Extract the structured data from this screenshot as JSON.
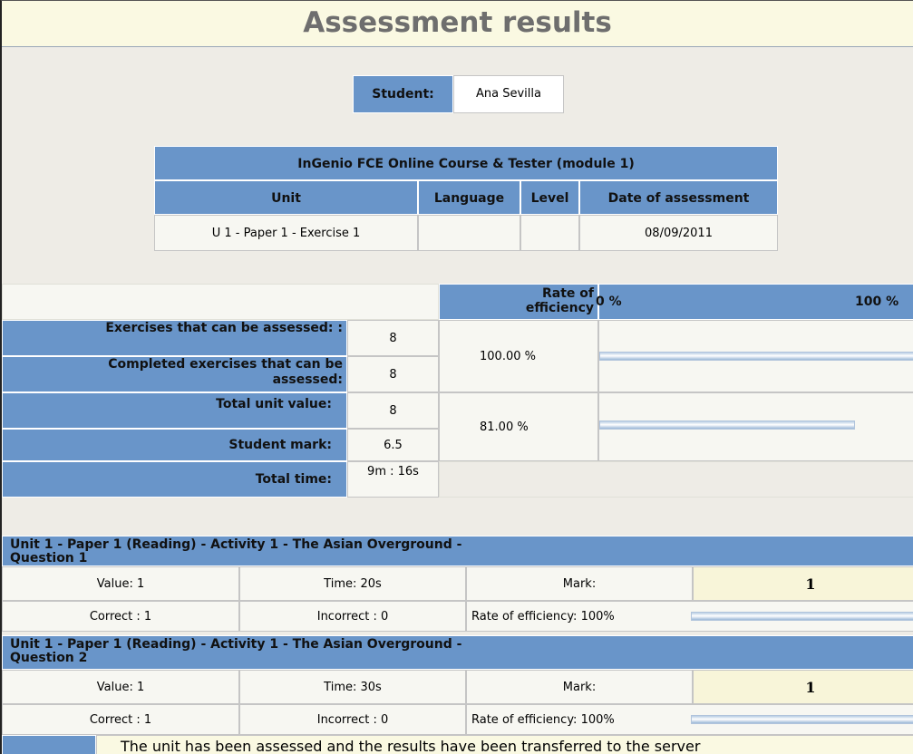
{
  "header": {
    "title": "Assessment results"
  },
  "student": {
    "label": "Student:",
    "name": "Ana Sevilla"
  },
  "course": {
    "title": "InGenio FCE Online Course & Tester (module 1)",
    "columns": [
      "Unit",
      "Language",
      "Level",
      "Date of assessment"
    ],
    "row": {
      "unit": "U 1 - Paper 1 - Exercise 1",
      "language": "",
      "level": "",
      "date": "08/09/2011"
    }
  },
  "summary": {
    "rate_label": "Rate of efficiency",
    "scale_min": "0 %",
    "scale_max": "100 %",
    "rows": [
      {
        "label": "Exercises that can be assessed: :",
        "value": "8"
      },
      {
        "label": "Completed exercises that can be assessed:",
        "value": "8"
      },
      {
        "label": "Total unit value:",
        "value": "8"
      },
      {
        "label": "Student mark:",
        "value": "6.5"
      },
      {
        "label": "Total time:",
        "value": "9m : 16s"
      }
    ],
    "rates": [
      {
        "text": "100.00 %",
        "fraction": 1.0
      },
      {
        "text": "81.00 %",
        "fraction": 0.81
      }
    ]
  },
  "questions": [
    {
      "title": "Unit 1 - Paper 1 (Reading) - Activity 1 - The Asian Overground - Question 1",
      "value": "Value: 1",
      "time": "Time: 20s",
      "mark_label": "Mark:",
      "mark": "1",
      "correct": "Correct : 1",
      "incorrect": "Incorrect : 0",
      "rate": "Rate of efficiency: 100%",
      "rate_fraction": 1.0
    },
    {
      "title": "Unit 1 - Paper 1 (Reading) - Activity 1 - The Asian Overground - Question 2",
      "value": "Value: 1",
      "time": "Time: 30s",
      "mark_label": "Mark:",
      "mark": "1",
      "correct": "Correct : 1",
      "incorrect": "Incorrect : 0",
      "rate": "Rate of efficiency: 100%",
      "rate_fraction": 1.0
    }
  ],
  "footer": {
    "message": "The unit has been assessed and the results have been transferred to the server"
  }
}
